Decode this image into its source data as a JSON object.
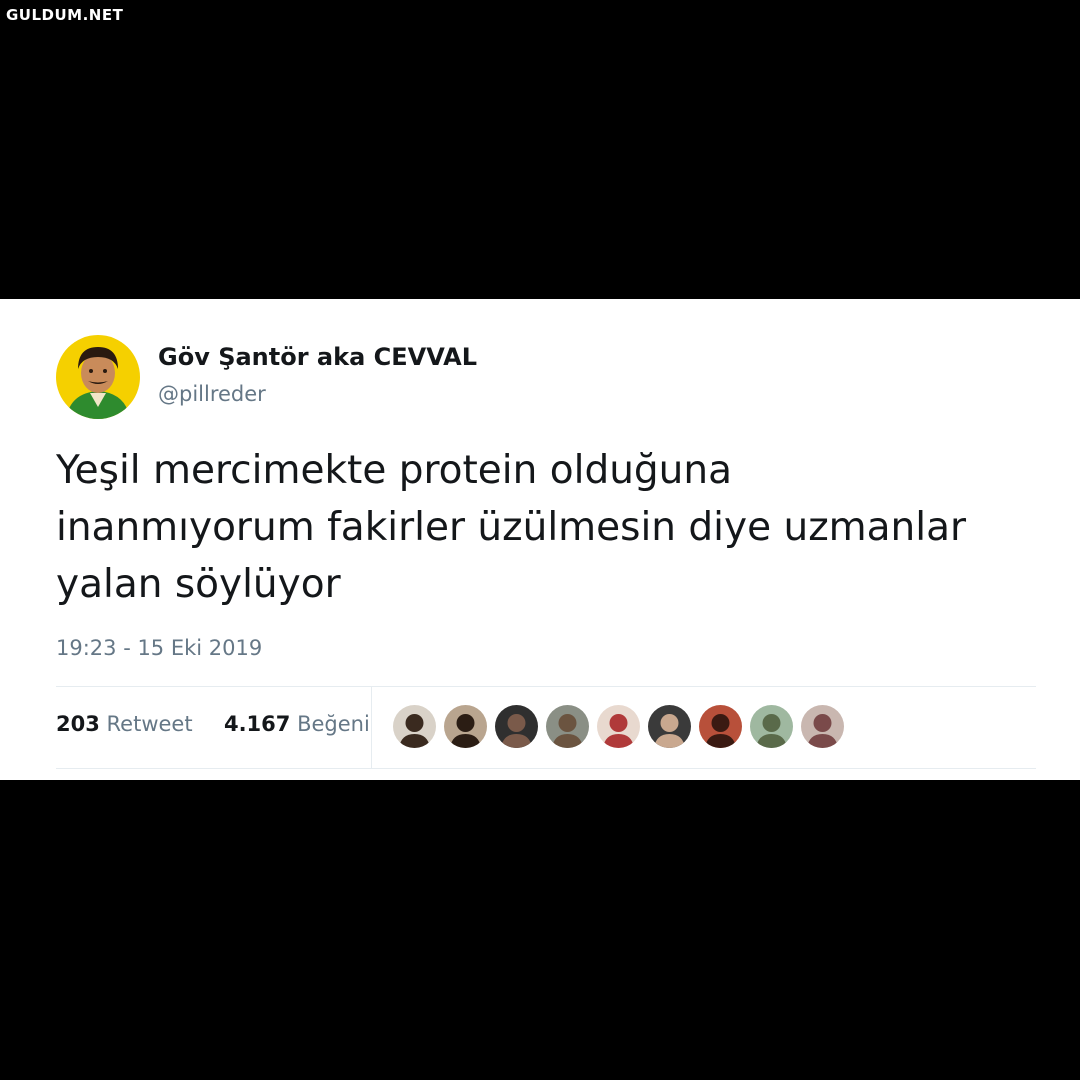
{
  "watermark": "GULDUM.NET",
  "tweet": {
    "display_name": "Göv Şantör aka CEVVAL",
    "handle": "@pillreder",
    "text": "Yeşil mercimekte protein olduğuna\ninanmıyorum fakirler üzülmesin diye uzmanlar\nyalan söylüyor",
    "timestamp": "19:23 - 15 Eki 2019"
  },
  "stats": {
    "retweet_count": "203",
    "retweet_label": "Retweet",
    "like_count": "4.167",
    "like_label": "Beğeni"
  },
  "likers": [
    {
      "icon": "avatar-icon",
      "bg": "#d9d2c8",
      "fg": "#3a2a1f"
    },
    {
      "icon": "avatar-icon",
      "bg": "#b9a58f",
      "fg": "#2b1d14"
    },
    {
      "icon": "avatar-icon",
      "bg": "#2f2f2f",
      "fg": "#7a5a4a"
    },
    {
      "icon": "avatar-icon",
      "bg": "#8a8f85",
      "fg": "#6b5440"
    },
    {
      "icon": "avatar-icon",
      "bg": "#e8d9cf",
      "fg": "#b03a3a"
    },
    {
      "icon": "avatar-icon",
      "bg": "#3a3a3a",
      "fg": "#c9a88f"
    },
    {
      "icon": "avatar-icon",
      "bg": "#b8503a",
      "fg": "#3a1a12"
    },
    {
      "icon": "avatar-icon",
      "bg": "#9fb8a0",
      "fg": "#5a6a4a"
    },
    {
      "icon": "avatar-icon",
      "bg": "#c9b7b0",
      "fg": "#7a4a4a"
    }
  ],
  "colors": {
    "background": "#000000",
    "card": "#ffffff",
    "text_primary": "#14171a",
    "text_secondary": "#657786",
    "divider": "#e6ecf0",
    "avatar_bg": "#f5d000",
    "avatar_shirt": "#2e8b2e"
  }
}
